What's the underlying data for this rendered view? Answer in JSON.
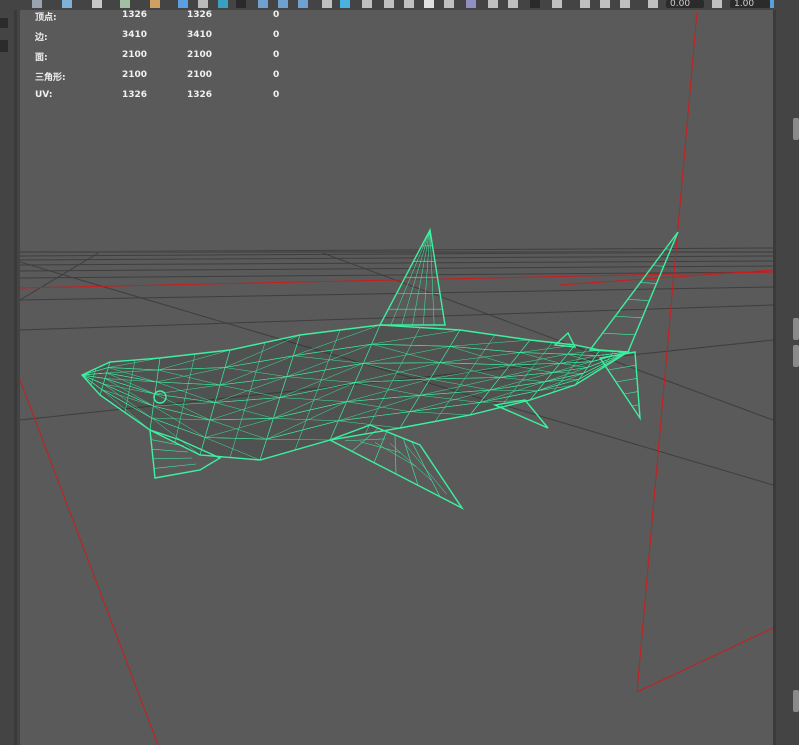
{
  "toolbar": {
    "field1_value": "0.00",
    "field2_value": "1.00"
  },
  "hud": {
    "rows": [
      {
        "label": "顶点:",
        "v1": "1326",
        "v2": "1326",
        "v3": "0"
      },
      {
        "label": "边:",
        "v1": "3410",
        "v2": "3410",
        "v3": "0"
      },
      {
        "label": "面:",
        "v1": "2100",
        "v2": "2100",
        "v3": "0"
      },
      {
        "label": "三角形:",
        "v1": "2100",
        "v2": "2100",
        "v3": "0"
      },
      {
        "label": "UV:",
        "v1": "1326",
        "v2": "1326",
        "v3": "0"
      }
    ]
  },
  "colors": {
    "wireframe": "#3df0a0",
    "camera_lines": "#c81e1e",
    "viewport_bg": "#5a5a5a",
    "grid": "#3c3c3c"
  },
  "icons": [
    "select-icon",
    "move-icon",
    "rotate-icon",
    "scale-icon",
    "grid-icon",
    "shaded-icon",
    "wireframe-icon",
    "camera-icon",
    "light-icon",
    "isolate-icon"
  ]
}
